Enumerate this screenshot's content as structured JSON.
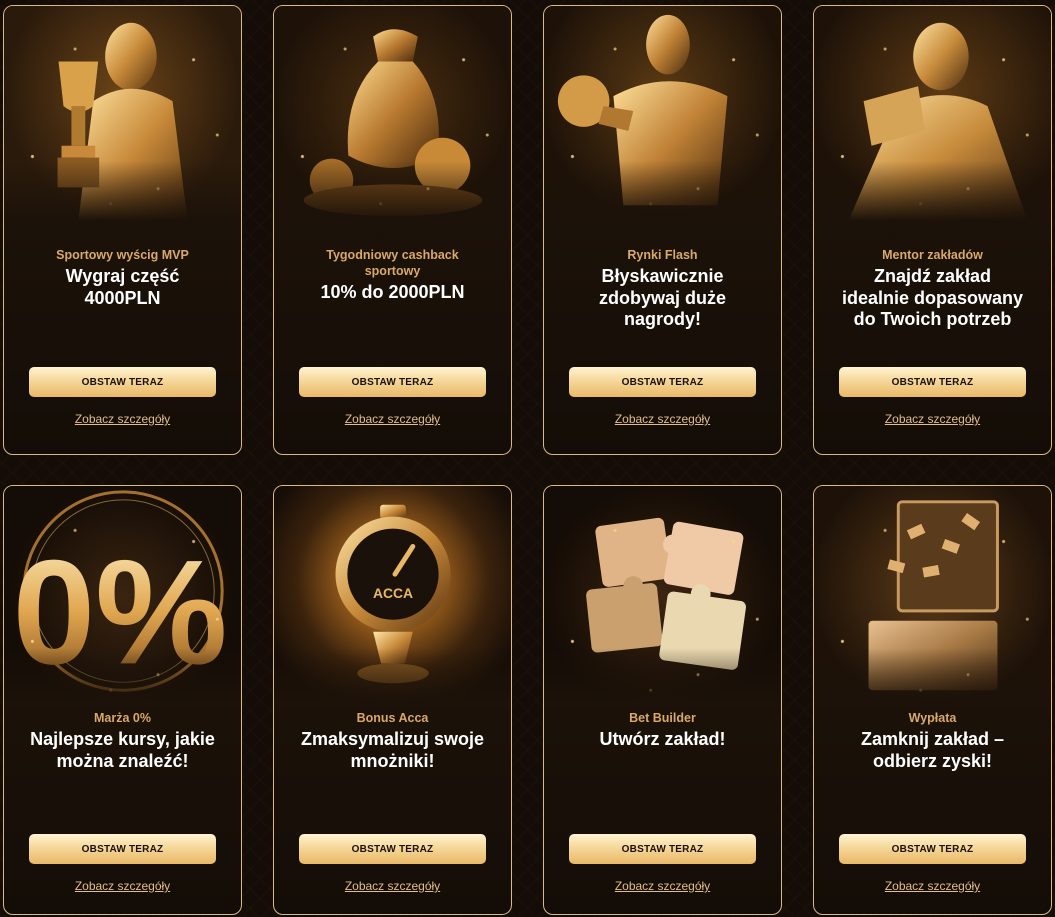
{
  "cards": [
    {
      "subtitle": "Sportowy wyścig MVP",
      "headline": "Wygraj część 4000PLN",
      "cta": "OBSTAW TERAZ",
      "details": "Zobacz szczegóły",
      "icon": "gold-woman-with-trophy-icon"
    },
    {
      "subtitle": "Tygodniowy cashback sportowy",
      "headline": "10% do 2000PLN",
      "cta": "OBSTAW TERAZ",
      "details": "Zobacz szczegóły",
      "icon": "gold-money-bag-icon"
    },
    {
      "subtitle": "Rynki Flash",
      "headline": "Błyskawicznie zdobywaj duże nagrody!",
      "cta": "OBSTAW TERAZ",
      "details": "Zobacz szczegóły",
      "icon": "gold-man-with-ball-icon"
    },
    {
      "subtitle": "Mentor zakładów",
      "headline": "Znajdź zakład idealnie dopasowany do Twoich potrzeb",
      "cta": "OBSTAW TERAZ",
      "details": "Zobacz szczegóły",
      "icon": "gold-woman-reading-icon"
    },
    {
      "subtitle": "Marża 0%",
      "headline": "Najlepsze kursy, jakie można znaleźć!",
      "cta": "OBSTAW TERAZ",
      "details": "Zobacz szczegóły",
      "icon": "zero-percent-icon",
      "art_text": "0%"
    },
    {
      "subtitle": "Bonus Acca",
      "headline": "Zmaksymalizuj swoje mnożniki!",
      "cta": "OBSTAW TERAZ",
      "details": "Zobacz szczegóły",
      "icon": "acca-gauge-icon",
      "art_text": "ACCA"
    },
    {
      "subtitle": "Bet Builder",
      "headline": "Utwórz zakład!",
      "cta": "OBSTAW TERAZ",
      "details": "Zobacz szczegóły",
      "icon": "puzzle-pieces-icon"
    },
    {
      "subtitle": "Wypłata",
      "headline": "Zamknij zakład – odbierz zyski!",
      "cta": "OBSTAW TERAZ",
      "details": "Zobacz szczegóły",
      "icon": "safe-with-money-icon"
    }
  ],
  "colors": {
    "accent_gold": "#e9b867",
    "subtitle": "#d9a86a",
    "border": "#d8b98a",
    "background": "#140c06"
  }
}
